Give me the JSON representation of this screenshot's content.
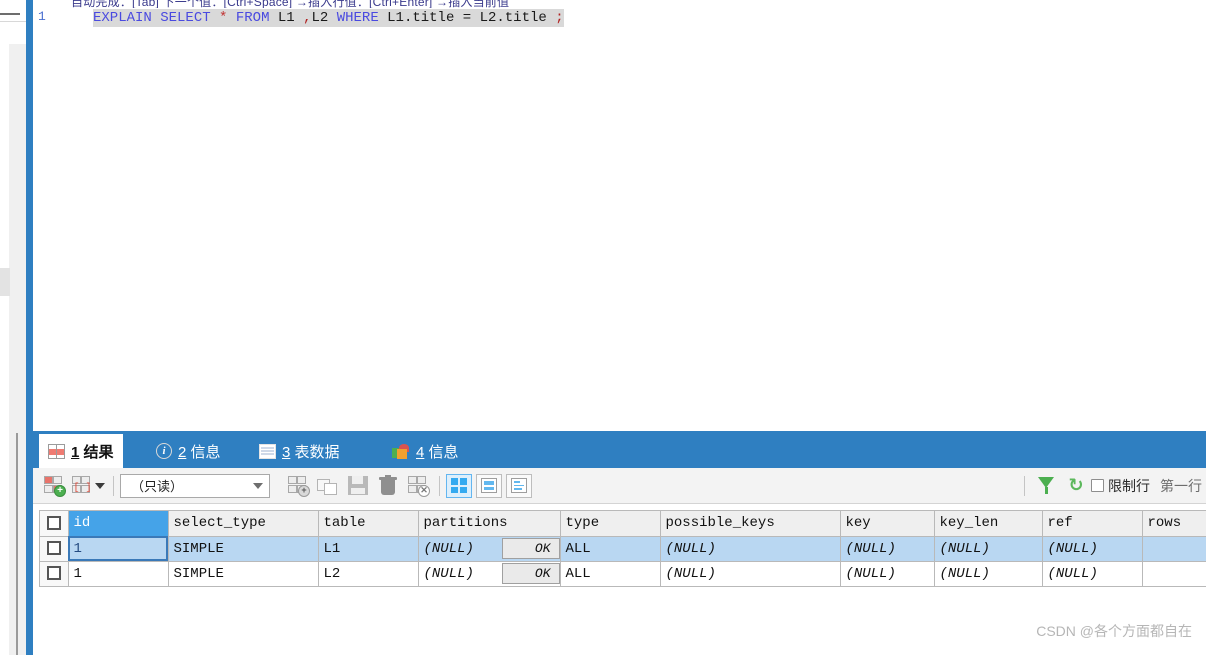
{
  "editor": {
    "clipped_top_text": "自动完成：[Tab]  下一个值：[Ctrl+Space]  →插入行值：[Ctrl+Enter]  →插入当前值",
    "line_number": "1",
    "sql_tokens": [
      {
        "t": "EXPLAIN",
        "k": "kw"
      },
      {
        "t": " ",
        "k": "sp"
      },
      {
        "t": "SELECT",
        "k": "kw"
      },
      {
        "t": " ",
        "k": "sp"
      },
      {
        "t": "*",
        "k": "star"
      },
      {
        "t": " ",
        "k": "sp"
      },
      {
        "t": "FROM",
        "k": "kw"
      },
      {
        "t": " ",
        "k": "sp"
      },
      {
        "t": "L1",
        "k": "idt"
      },
      {
        "t": " ",
        "k": "sp"
      },
      {
        "t": ",",
        "k": "punc"
      },
      {
        "t": "L2",
        "k": "idt"
      },
      {
        "t": " ",
        "k": "sp"
      },
      {
        "t": "WHERE",
        "k": "kw"
      },
      {
        "t": " ",
        "k": "sp"
      },
      {
        "t": "L1.title",
        "k": "idt"
      },
      {
        "t": " ",
        "k": "sp"
      },
      {
        "t": "=",
        "k": "opr"
      },
      {
        "t": " ",
        "k": "sp"
      },
      {
        "t": "L2.title",
        "k": "idt"
      },
      {
        "t": " ",
        "k": "sp"
      },
      {
        "t": ";",
        "k": "punc"
      }
    ],
    "sql_plain": "EXPLAIN SELECT * FROM L1 ,L2 WHERE L1.title = L2.title ;"
  },
  "tabs": [
    {
      "num": "1",
      "label": "结果",
      "icon": "result-grid-icon",
      "active": true
    },
    {
      "num": "2",
      "label": "信息",
      "icon": "info-circle-icon",
      "active": false
    },
    {
      "num": "3",
      "label": "表数据",
      "icon": "table-data-icon",
      "active": false
    },
    {
      "num": "4",
      "label": "信息",
      "icon": "profile-chart-icon",
      "active": false
    }
  ],
  "toolbar": {
    "add_record": "添加记录",
    "record_options": "记录选项",
    "mode_value": "（只读）",
    "mode_options": [
      "（只读）"
    ],
    "apply_change": "应用改变",
    "copy_record": "复制记录",
    "save_record": "保存记录",
    "delete_record": "删除记录",
    "cancel_change": "取消改变",
    "view_grid": "网格查看",
    "view_form": "表单查看",
    "view_field": "备注查看",
    "filter": "筛选",
    "refresh": "刷新",
    "limit_checkbox_label": "限制行",
    "limit_checked": false,
    "first_row_label": "第一行"
  },
  "grid": {
    "columns": [
      "id",
      "select_type",
      "table",
      "partitions",
      "type",
      "possible_keys",
      "key",
      "key_len",
      "ref",
      "rows"
    ],
    "selected_column": "id",
    "rows": [
      {
        "selected": true,
        "cells": {
          "id": "1",
          "select_type": "SIMPLE",
          "table": "L1",
          "partitions": "(NULL)",
          "partitions_button": "OK",
          "type": "ALL",
          "possible_keys": "(NULL)",
          "key": "(NULL)",
          "key_len": "(NULL)",
          "ref": "(NULL)",
          "rows": ""
        }
      },
      {
        "selected": false,
        "cells": {
          "id": "1",
          "select_type": "SIMPLE",
          "table": "L2",
          "partitions": "(NULL)",
          "partitions_button": "OK",
          "type": "ALL",
          "possible_keys": "(NULL)",
          "key": "(NULL)",
          "key_len": "(NULL)",
          "ref": "(NULL)",
          "rows": ""
        }
      }
    ]
  },
  "watermark": "CSDN @各个方面都自在",
  "colors": {
    "accent_blue": "#2f7fc1",
    "header_selected": "#45a3e8",
    "row_selected": "#b9d7f2",
    "keyword": "#4a4ae0",
    "star": "#c03030"
  }
}
